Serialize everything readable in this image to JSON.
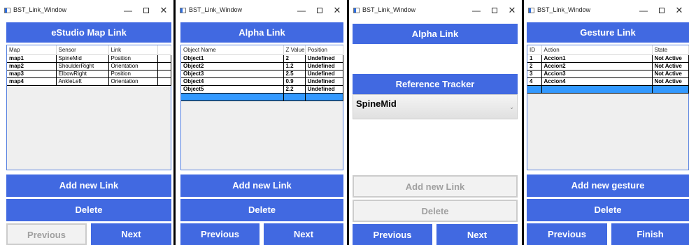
{
  "windows": [
    {
      "title": "BST_Link_Window",
      "header": "eStudio Map Link",
      "columns": [
        "Map",
        "Sensor",
        "Link"
      ],
      "rows": [
        [
          "map1",
          "SpineMid",
          "Position"
        ],
        [
          "map2",
          "ShoulderRight",
          "Orientation"
        ],
        [
          "map3",
          "ElbowRight",
          "Position"
        ],
        [
          "map4",
          "AnkleLeft",
          "Orientation"
        ]
      ],
      "add_label": "Add new Link",
      "delete_label": "Delete",
      "prev_label": "Previous",
      "next_label": "Next"
    },
    {
      "title": "BST_Link_Window",
      "header": "Alpha Link",
      "columns": [
        "Object Name",
        "Z Value",
        "Position"
      ],
      "rows": [
        [
          "Object1",
          "2",
          "Undefined"
        ],
        [
          "Object2",
          "1.2",
          "Undefined"
        ],
        [
          "Object3",
          "2.5",
          "Undefined"
        ],
        [
          "Object4",
          "0.9",
          "Undefined"
        ],
        [
          "Object5",
          "2.2",
          "Undefined"
        ]
      ],
      "add_label": "Add new Link",
      "delete_label": "Delete",
      "prev_label": "Previous",
      "next_label": "Next"
    },
    {
      "title": "BST_Link_Window",
      "header": "Alpha Link",
      "tracker_header": "Reference Tracker",
      "tracker_value": "SpineMid",
      "add_label": "Add new Link",
      "delete_label": "Delete",
      "prev_label": "Previous",
      "next_label": "Next"
    },
    {
      "title": "BST_Link_Window",
      "header": "Gesture Link",
      "columns": [
        "ID",
        "Action",
        "State"
      ],
      "rows": [
        [
          "1",
          "Accion1",
          "Not Active"
        ],
        [
          "2",
          "Accion2",
          "Not Active"
        ],
        [
          "3",
          "Accion3",
          "Not Active"
        ],
        [
          "4",
          "Accion4",
          "Not Active"
        ]
      ],
      "add_label": "Add new gesture",
      "delete_label": "Delete",
      "prev_label": "Previous",
      "finish_label": "Finish"
    }
  ],
  "titlebar": {
    "minimize": "—",
    "close": "✕"
  },
  "colors": {
    "accent": "#4169e1",
    "selection": "#3399ff",
    "disabled_bg": "#f2f2f2"
  }
}
